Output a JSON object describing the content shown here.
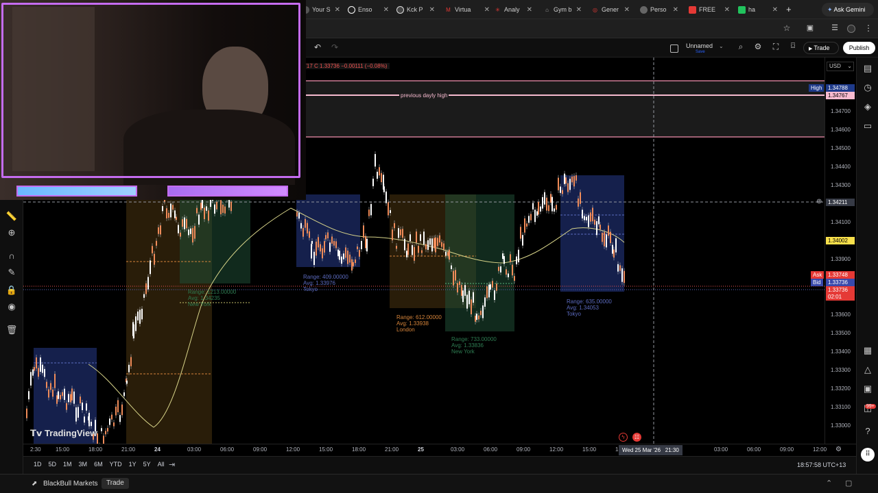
{
  "browser": {
    "tabs": [
      {
        "label": "Your S",
        "color": "#888888"
      },
      {
        "label": "Enso",
        "color": "#ffffff"
      },
      {
        "label": "Kck P",
        "color": "#dddddd"
      },
      {
        "label": "Virtua",
        "color": "#e53935"
      },
      {
        "label": "Analy",
        "color": "#e53935"
      },
      {
        "label": "Gym b",
        "color": "#9e9e9e"
      },
      {
        "label": "Gener",
        "color": "#e53935"
      },
      {
        "label": "Perso",
        "color": "#bbbbbb"
      },
      {
        "label": "FREE",
        "color": "#e53935"
      },
      {
        "label": "ha",
        "color": "#21c35d"
      }
    ],
    "new_tab": "+",
    "ask_gemini": "Ask Gemini"
  },
  "toolbar": {
    "layout_name": "Unnamed",
    "layout_sub": "Save",
    "trade_label": "Trade",
    "publish_label": "Publish",
    "ohlc_text": "3717  C 1.33736  −0.00111 (−0.08%)",
    "currency": "USD"
  },
  "chart_data": {
    "type": "candlestick",
    "symbol_broker": "BlackBull Markets",
    "x_ticks": [
      "2:30",
      "15:00",
      "18:00",
      "21:00",
      "24",
      "03:00",
      "06:00",
      "09:00",
      "12:00",
      "15:00",
      "18:00",
      "21:00",
      "25",
      "03:00",
      "06:00",
      "09:00",
      "12:00",
      "15:00",
      "18:00",
      "03:00",
      "06:00",
      "09:00",
      "12:00"
    ],
    "crosshair_time": "Wed 25 Mar '26   21:30",
    "y_ticks": [
      "1.34700",
      "1.34600",
      "1.34500",
      "1.34400",
      "1.34300",
      "1.34100",
      "1.33900",
      "1.33600",
      "1.33500",
      "1.33400",
      "1.33300",
      "1.33200",
      "1.33100",
      "1.33000"
    ],
    "price_labels": {
      "high_tag": "High",
      "high_value": "1.34788",
      "high_value2": "1.34767",
      "crosshair_price": "1.34211",
      "level_yellow": "1.34002",
      "ask_tag": "Ask",
      "ask_value": "1.33748",
      "bid_tag": "Bid",
      "bid_value": "1.33736",
      "last_value": "1.33736",
      "countdown": "02:01"
    },
    "annotations": {
      "daily_high": "previous dayly high"
    },
    "sessions": [
      {
        "range": "Range: 1213.00000",
        "avg": "Avg: 1.34235",
        "name": "New York",
        "color": "#2e7d52"
      },
      {
        "range": "Range: 409.00000",
        "avg": "Avg: 1.33976",
        "name": "Tokyo",
        "color": "#3f51b5"
      },
      {
        "range": "Range: 612.00000",
        "avg": "Avg: 1.33938",
        "name": "London",
        "color": "#d6843a"
      },
      {
        "range": "Range: 733.00000",
        "avg": "Avg: 1.33836",
        "name": "New York",
        "color": "#2e7d52"
      },
      {
        "range": "Range: 635.00000",
        "avg": "Avg: 1.34053",
        "name": "Tokyo",
        "color": "#3f51b5"
      }
    ],
    "watermark": "TradingView"
  },
  "bottom": {
    "ranges": [
      "1D",
      "5D",
      "1M",
      "3M",
      "6M",
      "YTD",
      "1Y",
      "5Y",
      "All"
    ],
    "clock": "18:57:58 UTC+13"
  },
  "footer": {
    "broker": "BlackBull Markets",
    "trade": "Trade"
  },
  "notification_badge": "99+"
}
